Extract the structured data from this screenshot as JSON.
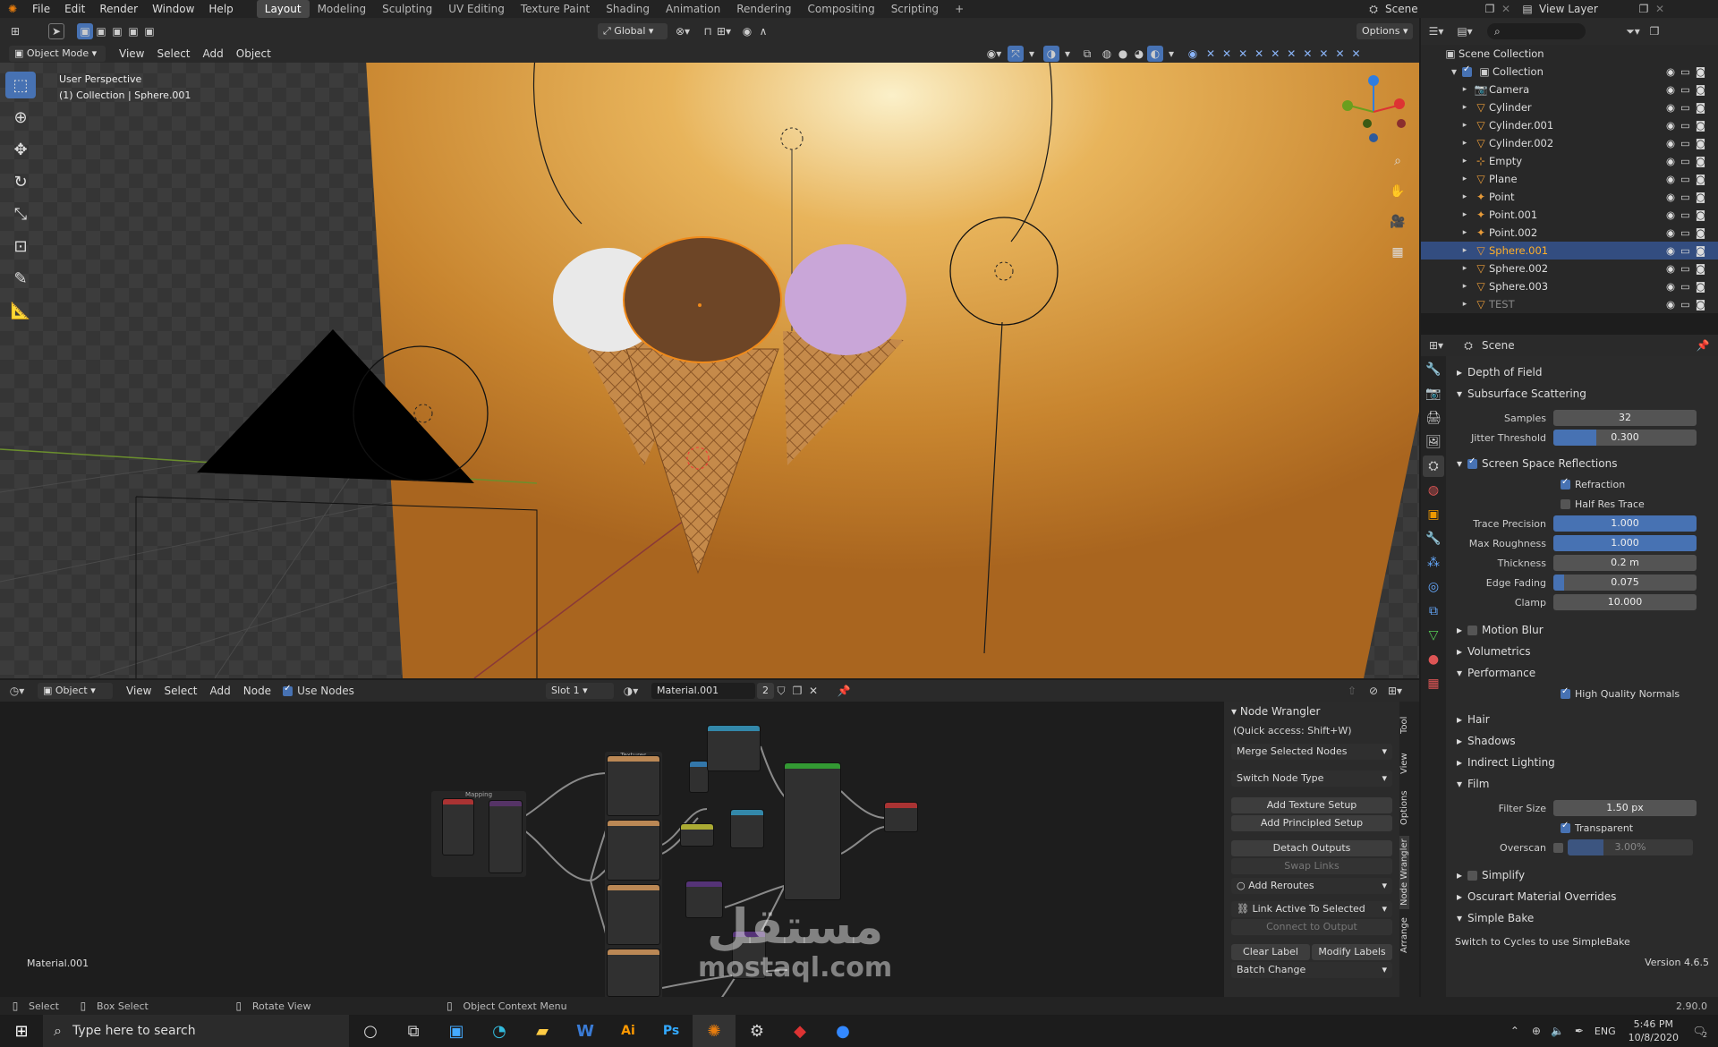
{
  "topbar": {
    "menus": [
      "File",
      "Edit",
      "Render",
      "Window",
      "Help"
    ],
    "workspaces": [
      "Layout",
      "Modeling",
      "Sculpting",
      "UV Editing",
      "Texture Paint",
      "Shading",
      "Animation",
      "Rendering",
      "Compositing",
      "Scripting"
    ],
    "active_workspace": "Layout",
    "scene": "Scene",
    "view_layer": "View Layer"
  },
  "viewport": {
    "mode": "Object Mode",
    "menus": [
      "View",
      "Select",
      "Add",
      "Object"
    ],
    "orientation": "Global",
    "options": "Options",
    "info_line1": "User Perspective",
    "info_line2": "(1) Collection | Sphere.001"
  },
  "outliner": {
    "root": "Scene Collection",
    "collection": "Collection",
    "items": [
      {
        "name": "Camera",
        "icon": "camera-icon"
      },
      {
        "name": "Cylinder",
        "icon": "mesh-icon"
      },
      {
        "name": "Cylinder.001",
        "icon": "mesh-icon"
      },
      {
        "name": "Cylinder.002",
        "icon": "mesh-icon"
      },
      {
        "name": "Empty",
        "icon": "empty-icon"
      },
      {
        "name": "Plane",
        "icon": "mesh-icon"
      },
      {
        "name": "Point",
        "icon": "light-icon"
      },
      {
        "name": "Point.001",
        "icon": "light-icon"
      },
      {
        "name": "Point.002",
        "icon": "light-icon"
      },
      {
        "name": "Sphere.001",
        "icon": "mesh-icon",
        "selected": true
      },
      {
        "name": "Sphere.002",
        "icon": "mesh-icon"
      },
      {
        "name": "Sphere.003",
        "icon": "mesh-icon"
      },
      {
        "name": "TEST",
        "icon": "mesh-icon",
        "dim": true
      }
    ]
  },
  "properties": {
    "context": "Scene",
    "depth_of_field": "Depth of Field",
    "sss": {
      "title": "Subsurface Scattering",
      "samples_label": "Samples",
      "samples": "32",
      "jitter_label": "Jitter Threshold",
      "jitter": "0.300",
      "jitter_fill": 0.3
    },
    "ssr": {
      "title": "Screen Space Reflections",
      "refraction": "Refraction",
      "half_res": "Half Res Trace",
      "trace_label": "Trace Precision",
      "trace": "1.000",
      "rough_label": "Max Roughness",
      "rough": "1.000",
      "thick_label": "Thickness",
      "thick": "0.2 m",
      "edge_label": "Edge Fading",
      "edge": "0.075",
      "edge_fill": 0.075,
      "clamp_label": "Clamp",
      "clamp": "10.000"
    },
    "motion_blur": "Motion Blur",
    "volumetrics": "Volumetrics",
    "performance": "Performance",
    "hq_normals": "High Quality Normals",
    "hair": "Hair",
    "shadows": "Shadows",
    "indirect": "Indirect Lighting",
    "film": "Film",
    "filter_label": "Filter Size",
    "filter": "1.50 px",
    "transparent": "Transparent",
    "overscan_label": "Overscan",
    "overscan": "3.00%",
    "simplify": "Simplify",
    "oscurart": "Oscurart Material Overrides",
    "simple_bake": "Simple Bake",
    "bake_note": "Switch to Cycles to use SimpleBake",
    "version": "Version 4.6.5"
  },
  "node_editor": {
    "type": "Object",
    "menus": [
      "View",
      "Select",
      "Add",
      "Node"
    ],
    "use_nodes": "Use Nodes",
    "slot": "Slot 1",
    "material": "Material.001",
    "users": "2",
    "label": "Material.001",
    "frame_textures": "Textures",
    "frame_mapping": "Mapping"
  },
  "node_wrangler": {
    "title": "Node Wrangler",
    "quick": "(Quick access: Shift+W)",
    "merge": "Merge Selected Nodes",
    "switch": "Switch Node Type",
    "add_tex": "Add Texture Setup",
    "add_pr": "Add Principled Setup",
    "detach": "Detach Outputs",
    "swap": "Swap Links",
    "reroutes": "Add Reroutes",
    "link_active": "Link Active To Selected",
    "connect": "Connect to Output",
    "clear": "Clear Label",
    "modify": "Modify Labels",
    "batch": "Batch Change",
    "tabs": [
      "Tool",
      "View",
      "Options",
      "Node Wrangler",
      "Arrange"
    ]
  },
  "statusbar": {
    "select": "Select",
    "box": "Box Select",
    "rotate": "Rotate View",
    "context": "Object Context Menu",
    "version": "2.90.0"
  },
  "taskbar": {
    "search": "Type here to search",
    "time": "5:46 PM",
    "date": "10/8/2020",
    "lang": "ENG",
    "notif": "2"
  },
  "watermark": {
    "ar": "مستقل",
    "en": "mostaql.com"
  }
}
